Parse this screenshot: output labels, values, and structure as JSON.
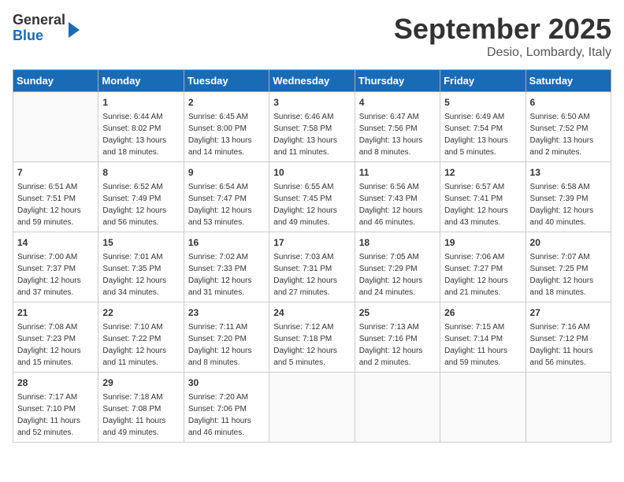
{
  "header": {
    "logo_general": "General",
    "logo_blue": "Blue",
    "month": "September 2025",
    "location": "Desio, Lombardy, Italy"
  },
  "days_of_week": [
    "Sunday",
    "Monday",
    "Tuesday",
    "Wednesday",
    "Thursday",
    "Friday",
    "Saturday"
  ],
  "weeks": [
    [
      {
        "day": "",
        "empty": true
      },
      {
        "day": "1",
        "sunrise": "6:44 AM",
        "sunset": "8:02 PM",
        "daylight": "13 hours and 18 minutes."
      },
      {
        "day": "2",
        "sunrise": "6:45 AM",
        "sunset": "8:00 PM",
        "daylight": "13 hours and 14 minutes."
      },
      {
        "day": "3",
        "sunrise": "6:46 AM",
        "sunset": "7:58 PM",
        "daylight": "13 hours and 11 minutes."
      },
      {
        "day": "4",
        "sunrise": "6:47 AM",
        "sunset": "7:56 PM",
        "daylight": "13 hours and 8 minutes."
      },
      {
        "day": "5",
        "sunrise": "6:49 AM",
        "sunset": "7:54 PM",
        "daylight": "13 hours and 5 minutes."
      },
      {
        "day": "6",
        "sunrise": "6:50 AM",
        "sunset": "7:52 PM",
        "daylight": "13 hours and 2 minutes."
      }
    ],
    [
      {
        "day": "7",
        "sunrise": "6:51 AM",
        "sunset": "7:51 PM",
        "daylight": "12 hours and 59 minutes."
      },
      {
        "day": "8",
        "sunrise": "6:52 AM",
        "sunset": "7:49 PM",
        "daylight": "12 hours and 56 minutes."
      },
      {
        "day": "9",
        "sunrise": "6:54 AM",
        "sunset": "7:47 PM",
        "daylight": "12 hours and 53 minutes."
      },
      {
        "day": "10",
        "sunrise": "6:55 AM",
        "sunset": "7:45 PM",
        "daylight": "12 hours and 49 minutes."
      },
      {
        "day": "11",
        "sunrise": "6:56 AM",
        "sunset": "7:43 PM",
        "daylight": "12 hours and 46 minutes."
      },
      {
        "day": "12",
        "sunrise": "6:57 AM",
        "sunset": "7:41 PM",
        "daylight": "12 hours and 43 minutes."
      },
      {
        "day": "13",
        "sunrise": "6:58 AM",
        "sunset": "7:39 PM",
        "daylight": "12 hours and 40 minutes."
      }
    ],
    [
      {
        "day": "14",
        "sunrise": "7:00 AM",
        "sunset": "7:37 PM",
        "daylight": "12 hours and 37 minutes."
      },
      {
        "day": "15",
        "sunrise": "7:01 AM",
        "sunset": "7:35 PM",
        "daylight": "12 hours and 34 minutes."
      },
      {
        "day": "16",
        "sunrise": "7:02 AM",
        "sunset": "7:33 PM",
        "daylight": "12 hours and 31 minutes."
      },
      {
        "day": "17",
        "sunrise": "7:03 AM",
        "sunset": "7:31 PM",
        "daylight": "12 hours and 27 minutes."
      },
      {
        "day": "18",
        "sunrise": "7:05 AM",
        "sunset": "7:29 PM",
        "daylight": "12 hours and 24 minutes."
      },
      {
        "day": "19",
        "sunrise": "7:06 AM",
        "sunset": "7:27 PM",
        "daylight": "12 hours and 21 minutes."
      },
      {
        "day": "20",
        "sunrise": "7:07 AM",
        "sunset": "7:25 PM",
        "daylight": "12 hours and 18 minutes."
      }
    ],
    [
      {
        "day": "21",
        "sunrise": "7:08 AM",
        "sunset": "7:23 PM",
        "daylight": "12 hours and 15 minutes."
      },
      {
        "day": "22",
        "sunrise": "7:10 AM",
        "sunset": "7:22 PM",
        "daylight": "12 hours and 11 minutes."
      },
      {
        "day": "23",
        "sunrise": "7:11 AM",
        "sunset": "7:20 PM",
        "daylight": "12 hours and 8 minutes."
      },
      {
        "day": "24",
        "sunrise": "7:12 AM",
        "sunset": "7:18 PM",
        "daylight": "12 hours and 5 minutes."
      },
      {
        "day": "25",
        "sunrise": "7:13 AM",
        "sunset": "7:16 PM",
        "daylight": "12 hours and 2 minutes."
      },
      {
        "day": "26",
        "sunrise": "7:15 AM",
        "sunset": "7:14 PM",
        "daylight": "11 hours and 59 minutes."
      },
      {
        "day": "27",
        "sunrise": "7:16 AM",
        "sunset": "7:12 PM",
        "daylight": "11 hours and 56 minutes."
      }
    ],
    [
      {
        "day": "28",
        "sunrise": "7:17 AM",
        "sunset": "7:10 PM",
        "daylight": "11 hours and 52 minutes."
      },
      {
        "day": "29",
        "sunrise": "7:18 AM",
        "sunset": "7:08 PM",
        "daylight": "11 hours and 49 minutes."
      },
      {
        "day": "30",
        "sunrise": "7:20 AM",
        "sunset": "7:06 PM",
        "daylight": "11 hours and 46 minutes."
      },
      {
        "day": "",
        "empty": true
      },
      {
        "day": "",
        "empty": true
      },
      {
        "day": "",
        "empty": true
      },
      {
        "day": "",
        "empty": true
      }
    ]
  ]
}
